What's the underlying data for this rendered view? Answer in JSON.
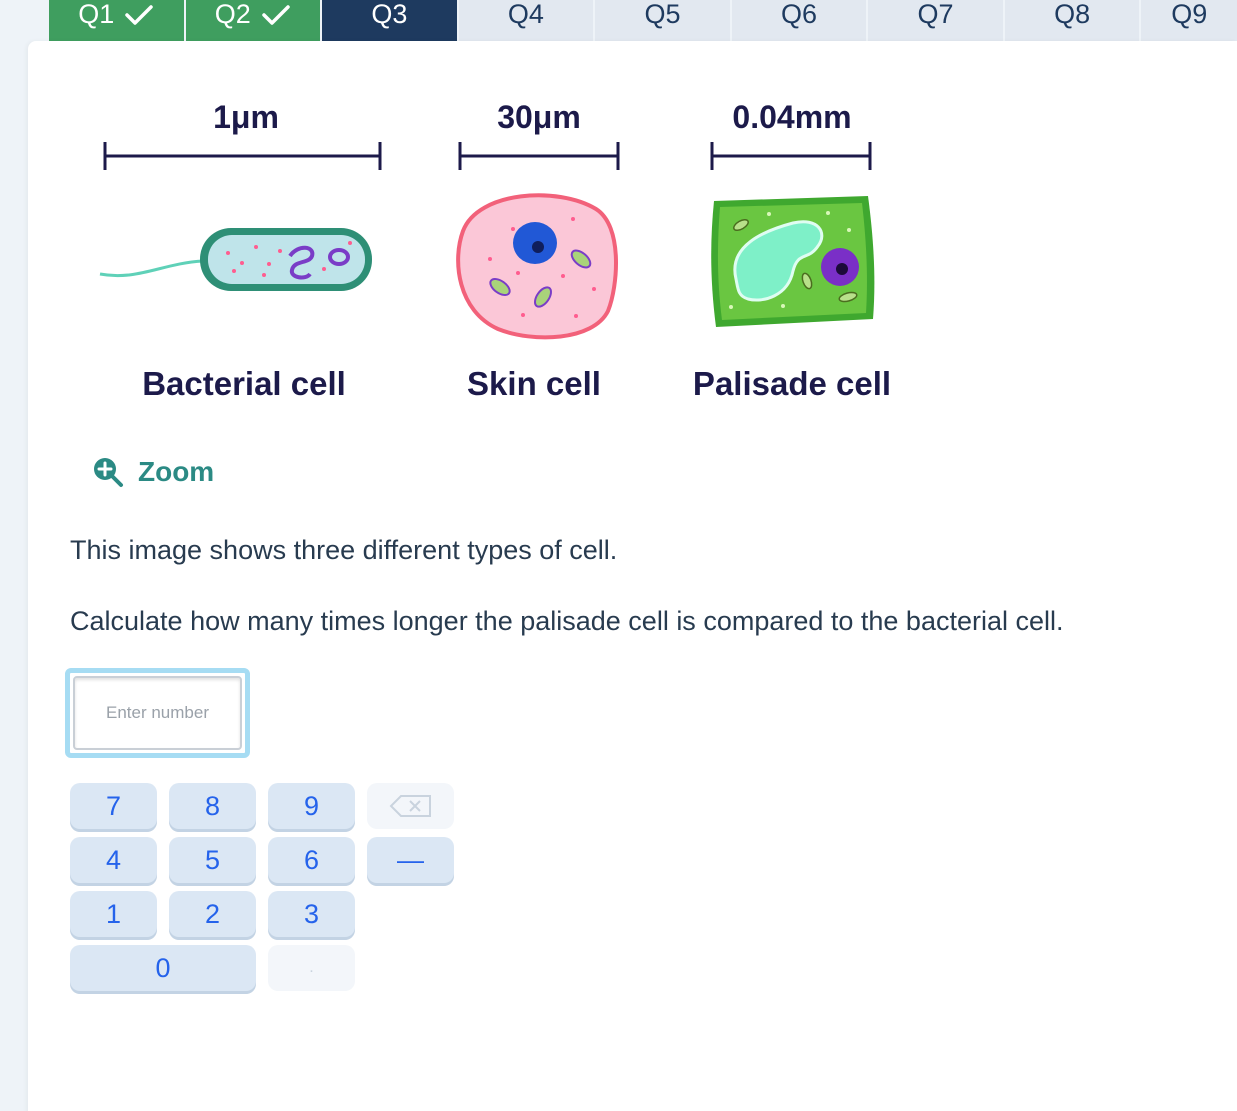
{
  "tabs": [
    {
      "label": "Q1",
      "state": "done"
    },
    {
      "label": "Q2",
      "state": "done"
    },
    {
      "label": "Q3",
      "state": "current"
    },
    {
      "label": "Q4",
      "state": "todo"
    },
    {
      "label": "Q5",
      "state": "todo"
    },
    {
      "label": "Q6",
      "state": "todo"
    },
    {
      "label": "Q7",
      "state": "todo"
    },
    {
      "label": "Q8",
      "state": "todo"
    },
    {
      "label": "Q9",
      "state": "todo"
    }
  ],
  "figure": {
    "cells": [
      {
        "name": "Bacterial cell",
        "scale": "1μm"
      },
      {
        "name": "Skin cell",
        "scale": "30μm"
      },
      {
        "name": "Palisade cell",
        "scale": "0.04mm"
      }
    ]
  },
  "zoom_label": "Zoom",
  "question": {
    "line1": "This image shows three different types of cell.",
    "line2": "Calculate how many times longer the palisade cell is compared to the bacterial cell."
  },
  "answer": {
    "placeholder": "Enter number",
    "value": ""
  },
  "keypad": {
    "keys": [
      "7",
      "8",
      "9",
      "4",
      "5",
      "6",
      "1",
      "2",
      "3",
      "0"
    ],
    "minus": "—",
    "decimal": "."
  },
  "colors": {
    "tab_done": "#3f9e5f",
    "tab_current": "#1e3a5f",
    "tab_todo": "#e2e8f0",
    "zoom": "#2b8a84",
    "key_text": "#2563eb"
  }
}
